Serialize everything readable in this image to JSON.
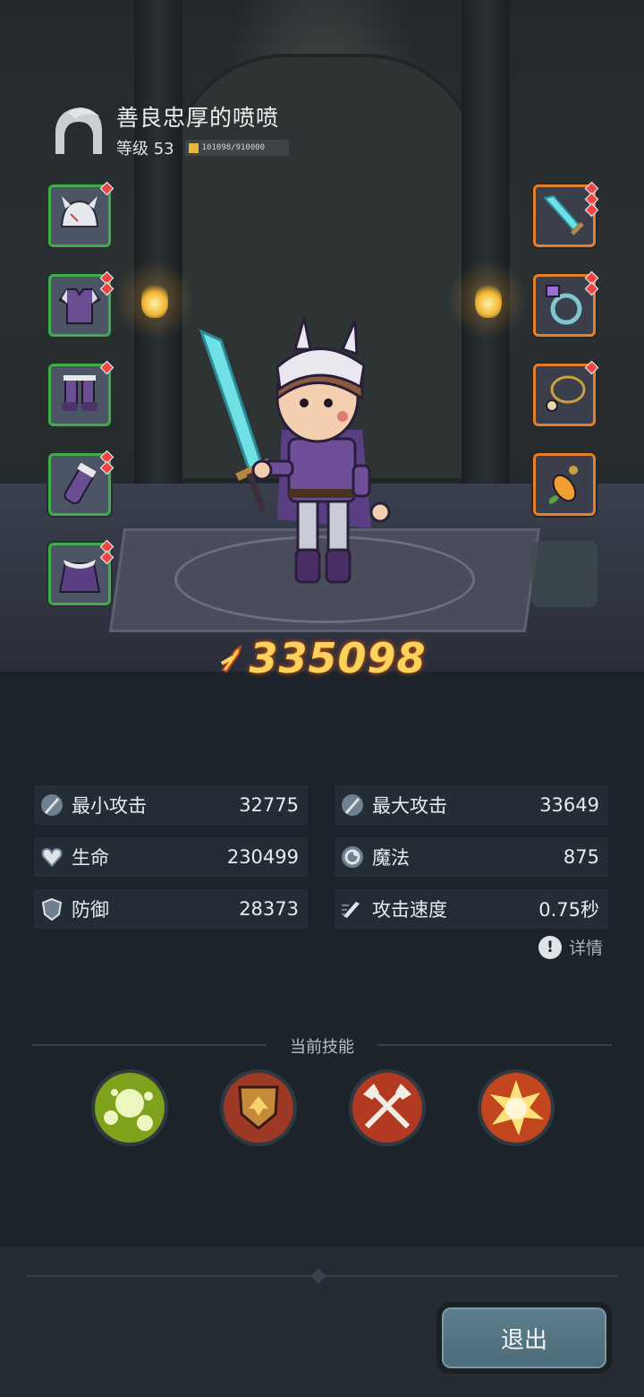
{
  "header": {
    "player_name": "善良忠厚的喷喷",
    "level_label": "等级 53",
    "exp_text": "101098/910000"
  },
  "equipment": {
    "left": [
      "helmet",
      "armor",
      "boots",
      "bracer",
      "cape"
    ],
    "right": [
      "sword",
      "ring",
      "necklace",
      "amulet"
    ]
  },
  "power": {
    "value": "335098"
  },
  "stats": {
    "min_attack": {
      "label": "最小攻击",
      "value": "32775"
    },
    "max_attack": {
      "label": "最大攻击",
      "value": "33649"
    },
    "hp": {
      "label": "生命",
      "value": "230499"
    },
    "mp": {
      "label": "魔法",
      "value": "875"
    },
    "defense": {
      "label": "防御",
      "value": "28373"
    },
    "attack_speed": {
      "label": "攻击速度",
      "value": "0.75秒"
    }
  },
  "detail_label": "详情",
  "skills": {
    "title": "当前技能",
    "items": [
      "poison-bubbles",
      "shield-crest",
      "crossed-axes",
      "explosion"
    ]
  },
  "exit_label": "退出",
  "colors": {
    "slot_green": "#3fae4a",
    "slot_orange": "#e2802f",
    "power_gold": "#fbd25a"
  }
}
